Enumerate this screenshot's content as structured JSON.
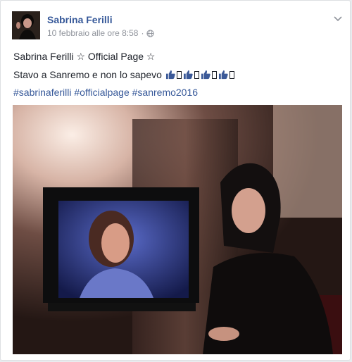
{
  "post": {
    "author": "Sabrina Ferilli",
    "timestamp": "10 febbraio alle ore 8:58",
    "separator": "·",
    "privacy_icon": "globe-icon",
    "options_icon": "chevron-down-icon",
    "line1": "Sabrina Ferilli ☆ Official Page ☆",
    "line2": "Stavo a Sanremo e non lo sapevo",
    "line2_emoji": "thumbs-up-icon",
    "hashtags": [
      "#sabrinaferilli",
      "#officialpage",
      "#sanremo2016"
    ]
  },
  "colors": {
    "link": "#365899",
    "text": "#1d2129",
    "meta": "#90949c"
  }
}
